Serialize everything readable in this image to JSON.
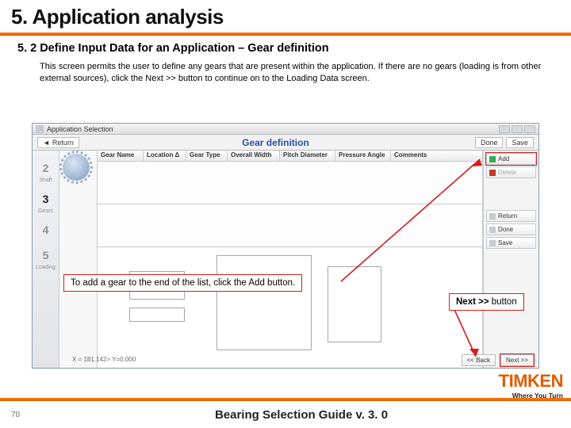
{
  "slide": {
    "title": "5. Application analysis",
    "subhead": "5. 2 Define Input Data for an Application – Gear definition",
    "body": "This screen permits the user to define any gears that are present within the application. If there are no gears (loading is from other external sources), click the Next >> button to continue on to the Loading Data screen."
  },
  "app": {
    "window_title": "Application Selection",
    "back_label": "Return",
    "panel_title": "Gear definition",
    "toolbar_done": "Done",
    "toolbar_save": "Save",
    "columns": {
      "c0": "Gear Name",
      "c1": "Location Δ",
      "c2": "Gear Type",
      "c3": "Overall Width",
      "c4": "Pitch Diameter",
      "c5": "Pressure Angle",
      "c6": "Comments"
    },
    "right_pane": {
      "add": "Add",
      "del": "Delete",
      "return": "Return",
      "done": "Done",
      "save": "Save"
    },
    "steps": {
      "s2": "2",
      "s2_lab": "Shaft",
      "s3": "3",
      "s3_lab": "Gears",
      "s4": "4",
      "s5": "5",
      "s5_lab": "Loading"
    },
    "status": "X = 181.142> Y=0.000",
    "footer_back": "<< Back",
    "footer_next": "Next >>",
    "step_label": "Gear ring"
  },
  "callouts": {
    "add_tip": "To add a gear to the end of the list, click the Add button.",
    "next_label_pre": "Next >> ",
    "next_label_post": "button"
  },
  "footer": {
    "page": "70",
    "title": "Bearing Selection Guide v. 3. 0"
  },
  "brand": {
    "name": "TIMKEN",
    "tag": "Where You Turn"
  }
}
